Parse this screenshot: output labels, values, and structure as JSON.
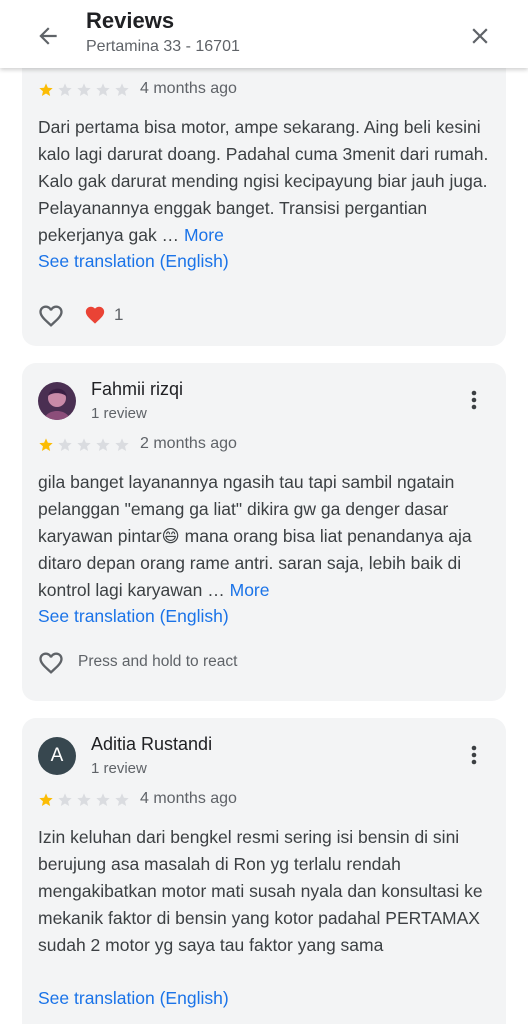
{
  "header": {
    "title": "Reviews",
    "subtitle": "Pertamina 33 - 16701",
    "back_icon": "arrow-back-icon",
    "close_icon": "close-icon"
  },
  "colors": {
    "star_filled": "#fbbc04",
    "star_empty": "#dadce0",
    "link": "#1a73e8",
    "card_bg": "#f3f4f5",
    "reaction_heart": "#ea4335"
  },
  "reviews": [
    {
      "rating": 1,
      "time": "4 months ago",
      "text": "Dari pertama bisa motor, ampe sekarang. Aing beli kesini kalo lagi darurat doang. Padahal cuma 3menit dari rumah. Kalo gak darurat mending ngisi kecipayung biar jauh juga. Pelayanannya enggak banget. Transisi pergantian pekerjanya gak …",
      "more": "More",
      "translation": "See translation (English)",
      "reaction_count": "1"
    },
    {
      "author": "Fahmii rizqi",
      "reviews_count": "1 review",
      "rating": 1,
      "time": "2 months ago",
      "text": "gila banget layanannya ngasih tau tapi sambil ngatain pelanggan \"emang ga liat\" dikira gw ga denger dasar karyawan pintar😄 mana orang bisa liat penandanya aja ditaro depan orang rame antri. saran saja, lebih baik di kontrol lagi karyawan …",
      "more": "More",
      "translation": "See translation (English)",
      "react_hint": "Press and hold to react"
    },
    {
      "author": "Aditia Rustandi",
      "avatar_letter": "A",
      "reviews_count": "1 review",
      "rating": 1,
      "time": "4 months ago",
      "text": "Izin keluhan dari bengkel resmi sering isi bensin di sini berujung asa masalah di Ron yg terlalu rendah mengakibatkan motor mati susah nyala dan konsultasi ke mekanik faktor di bensin yang kotor padahal PERTAMAX sudah 2 motor yg saya tau faktor yang sama",
      "translation": "See translation (English)"
    }
  ]
}
